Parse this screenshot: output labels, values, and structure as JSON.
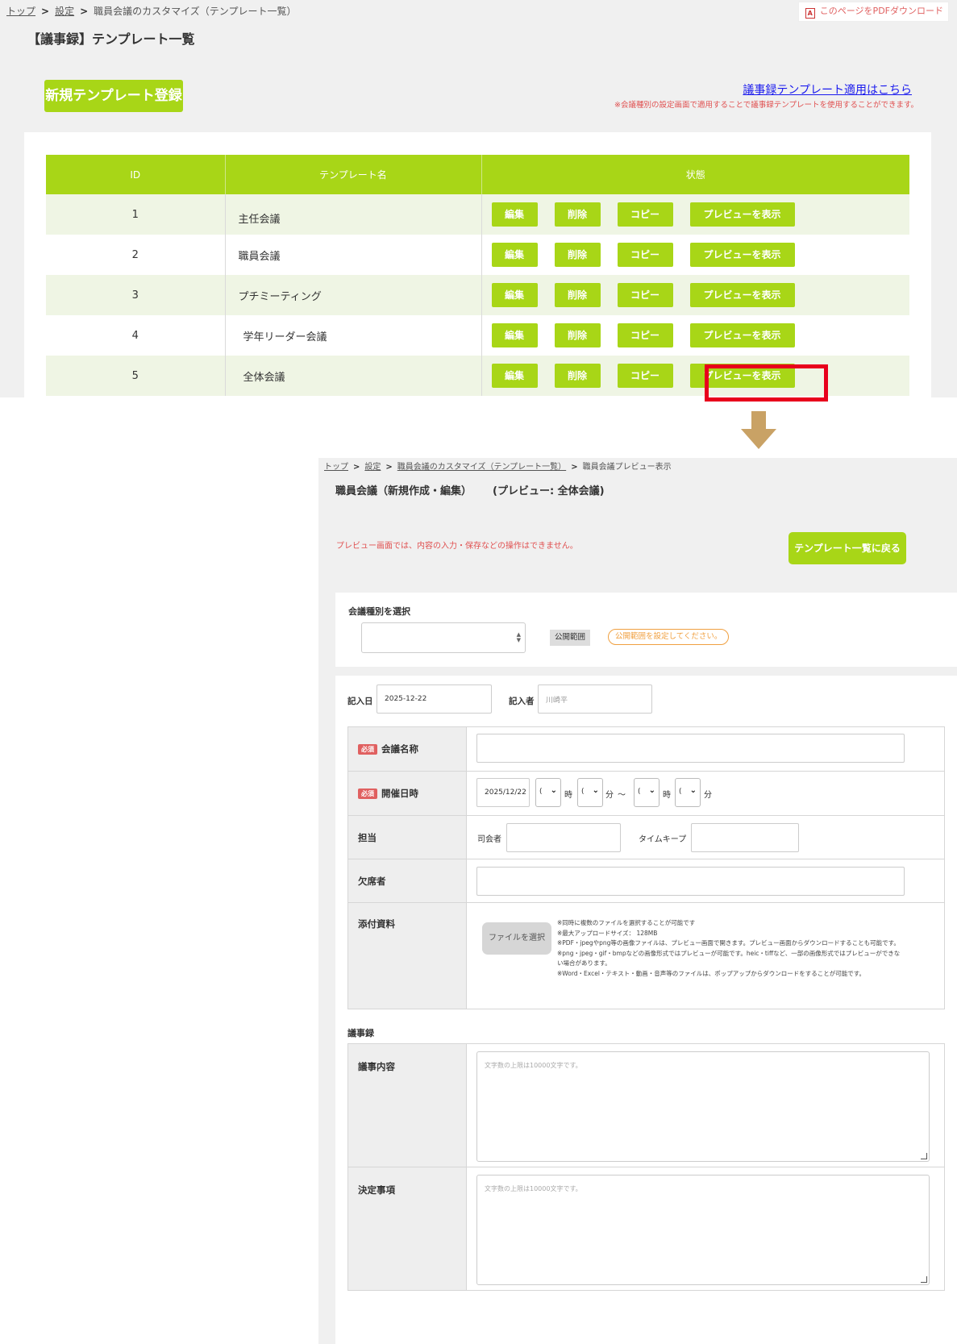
{
  "top": {
    "breadcrumb": {
      "home": "トップ",
      "settings": "設定",
      "current": "職員会議のカスタマイズ（テンプレート一覧）"
    },
    "pdf_link": "このページをPDFダウンロード",
    "title": "【議事録】テンプレート一覧",
    "new_button": "新規テンプレート登録",
    "apply_link": "議事録テンプレート適用はこちら",
    "apply_note": "※会議種別の設定画面で適用することで議事録テンプレートを使用することができます。",
    "table": {
      "headers": [
        "ID",
        "テンプレート名",
        "状態"
      ],
      "rows": [
        {
          "id": "1",
          "name": "主任会議"
        },
        {
          "id": "2",
          "name": "職員会議"
        },
        {
          "id": "3",
          "name": "プチミーティング"
        },
        {
          "id": "4",
          "name": "学年リーダー会議"
        },
        {
          "id": "5",
          "name": "全体会議"
        }
      ],
      "actions": {
        "edit": "編集",
        "delete": "削除",
        "copy": "コピー",
        "preview": "プレビューを表示"
      }
    }
  },
  "bottom": {
    "breadcrumb": {
      "home": "トップ",
      "settings": "設定",
      "customize": "職員会議のカスタマイズ（テンプレート一覧）",
      "current": "職員会議プレビュー表示"
    },
    "title": "職員会議（新規作成・編集）",
    "preview_label": "(プレビュー: 全体会議)",
    "notice": "プレビュー画面では、内容の入力・保存などの操作はできません。",
    "back_button": "テンプレート一覧に戻る",
    "meeting_type_label": "会議種別を選択",
    "scope_label": "公開範囲",
    "scope_warning": "公開範囲を設定してください。",
    "entry_date_label": "記入日",
    "entry_date_value": "2025-12-22",
    "author_label": "記入者",
    "author_value": "川崎平",
    "required_badge": "必須",
    "meeting_name_label": "会議名称",
    "datetime_label": "開催日時",
    "date_value": "2025/12/22",
    "hour_unit": "時",
    "minute_unit": "分",
    "range_sep": "〜",
    "time_select_value": "(",
    "charge_label": "担当",
    "chair_label": "司会者",
    "timekeeper_label": "タイムキープ",
    "absent_label": "欠席者",
    "attachment_label": "添付資料",
    "file_button": "ファイルを選択",
    "file_notes": [
      "※同時に複数のファイルを選択することが可能です",
      "※最大アップロードサイズ： 128MB",
      "※PDF・jpegやpng等の画像ファイルは、プレビュー画面で開きます。プレビュー画面からダウンロードすることも可能です。",
      "※png・jpeg・gif・bmpなどの画像形式ではプレビューが可能です。heic・tiffなど、一部の画像形式ではプレビューができない場合があります。",
      "※Word・Excel・テキスト・動画・音声等のファイルは、ポップアップからダウンロードをすることが可能です。"
    ],
    "minutes_heading": "議事録",
    "agenda_label": "議事内容",
    "decision_label": "決定事項",
    "textarea_placeholder": "文字数の上限は10000文字です。"
  }
}
